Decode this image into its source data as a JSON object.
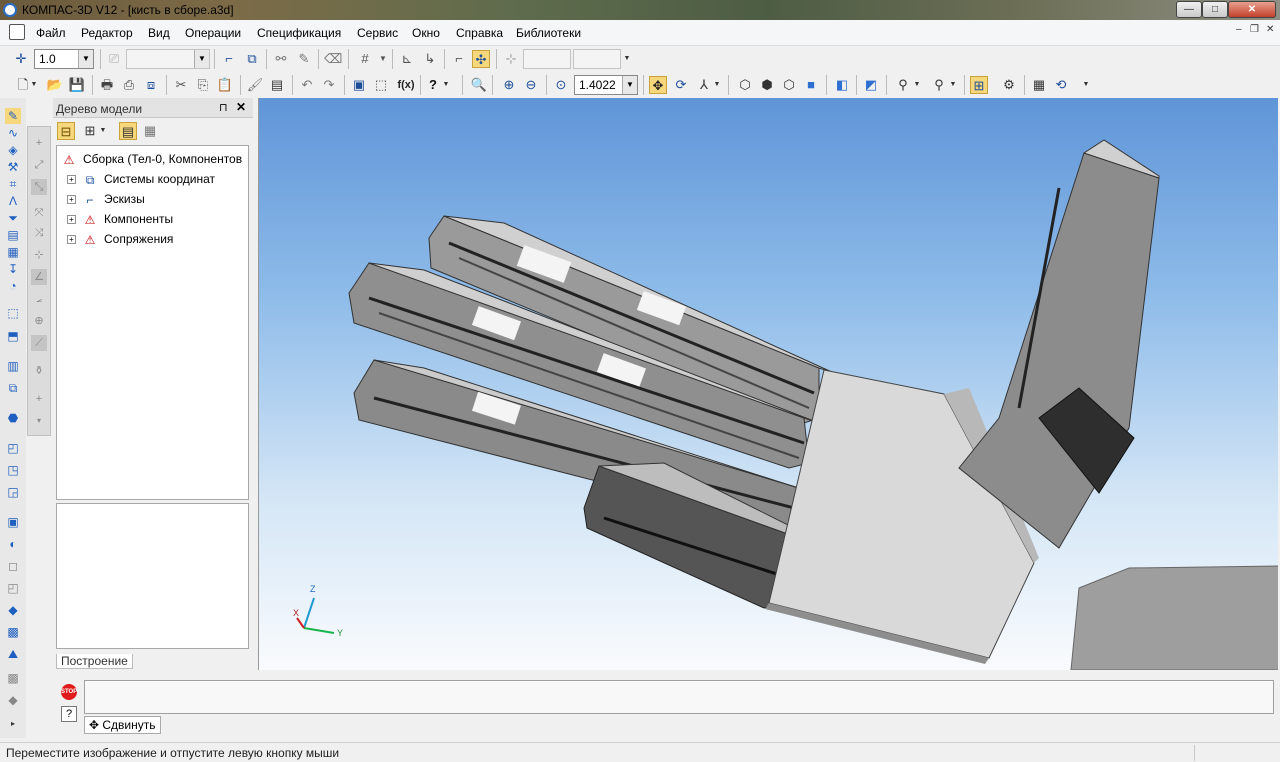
{
  "window": {
    "title": "КОМПАС-3D V12 - [кисть в сборе.a3d]",
    "controls": {
      "minimize": "—",
      "maximize": "□",
      "close": "✕"
    }
  },
  "menu": {
    "items": [
      "Файл",
      "Редактор",
      "Вид",
      "Операции",
      "Спецификация",
      "Сервис",
      "Окно",
      "Справка",
      "Библиотеки"
    ],
    "doc_controls": {
      "minimize": "–",
      "restore": "❐",
      "close": "✕"
    }
  },
  "toolbar1": {
    "step_value": "1.0"
  },
  "toolbar2": {
    "zoom_value": "1.4022",
    "fx_label": "f(x)"
  },
  "tree": {
    "title": "Дерево модели",
    "pin": "⊓",
    "close": "✕",
    "root": "Сборка (Тел-0, Компонентов",
    "nodes": [
      "Системы координат",
      "Эскизы",
      "Компоненты",
      "Сопряжения"
    ],
    "tab": "Построение"
  },
  "viewport": {
    "axis_x": "X",
    "axis_y": "Y",
    "axis_z": "Z"
  },
  "command_panel": {
    "stop_label": "STOP",
    "help_label": "?",
    "tab": "Сдвинуть"
  },
  "status": {
    "text": "Переместите изображение и отпустите левую кнопку мыши"
  },
  "colors": {
    "viewport_top": "#5f95d8",
    "viewport_bottom": "#f9fbfd",
    "model_light": "#d8d8d8",
    "model_dark": "#4a4a4a"
  }
}
